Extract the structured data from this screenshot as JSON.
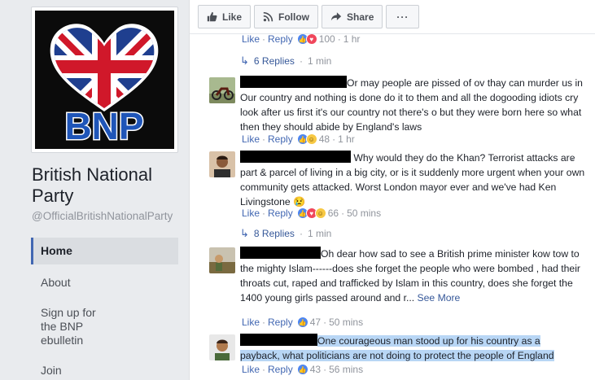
{
  "page": {
    "name": "British National Party",
    "handle": "@OfficialBritishNationalParty",
    "logo_text": "BNP"
  },
  "nav": [
    {
      "label": "Home"
    },
    {
      "label": "About"
    },
    {
      "label": "Sign up for the BNP ebulletin"
    },
    {
      "label": "Join"
    }
  ],
  "actions": {
    "like": "Like",
    "follow": "Follow",
    "share": "Share",
    "more": "···"
  },
  "ui": {
    "like": "Like",
    "reply": "Reply",
    "dot": "·",
    "see_more": "See More"
  },
  "top_meta": {
    "count": "100",
    "time": "1 hr"
  },
  "thread1_replies": {
    "label": "6 Replies",
    "time": "1 min"
  },
  "comments": [
    {
      "text": "Or may people are pissed of ov thay can murder us in Our country and nothing is done do it to them and all the dogooding idiots cry look after us first it's our country not there's o but they were born here so what then they should abide by England's laws",
      "count": "48",
      "time": "1 hr"
    },
    {
      "text": "Why would they do the Khan? Terrorist attacks are part & parcel of living in a big city, or is it suddenly more urgent when your own community gets attacked. Worst London mayor ever and we've had Ken Livingstone",
      "emoji": "😢",
      "count": "66",
      "time": "50 mins"
    },
    {
      "text": "Oh dear how sad to see a British prime minister kow tow to the mighty Islam------does she forget the people who were bombed , had their throats cut, raped and trafficked by Islam in this country, does she forget the 1400 young girls passed around and r...",
      "count": "47",
      "time": "50 mins"
    },
    {
      "text_line1": "One courageous man stood up for his country as a",
      "text_line2": "payback, what politicians are not doing to protect the people of England",
      "count": "43",
      "time": "56 mins"
    }
  ],
  "thread2_replies": {
    "label": "8 Replies",
    "time": "1 min"
  },
  "colors": {
    "accent": "#4267b2",
    "link": "#365899",
    "muted": "#90949c",
    "highlight": "#b8d6f5"
  }
}
